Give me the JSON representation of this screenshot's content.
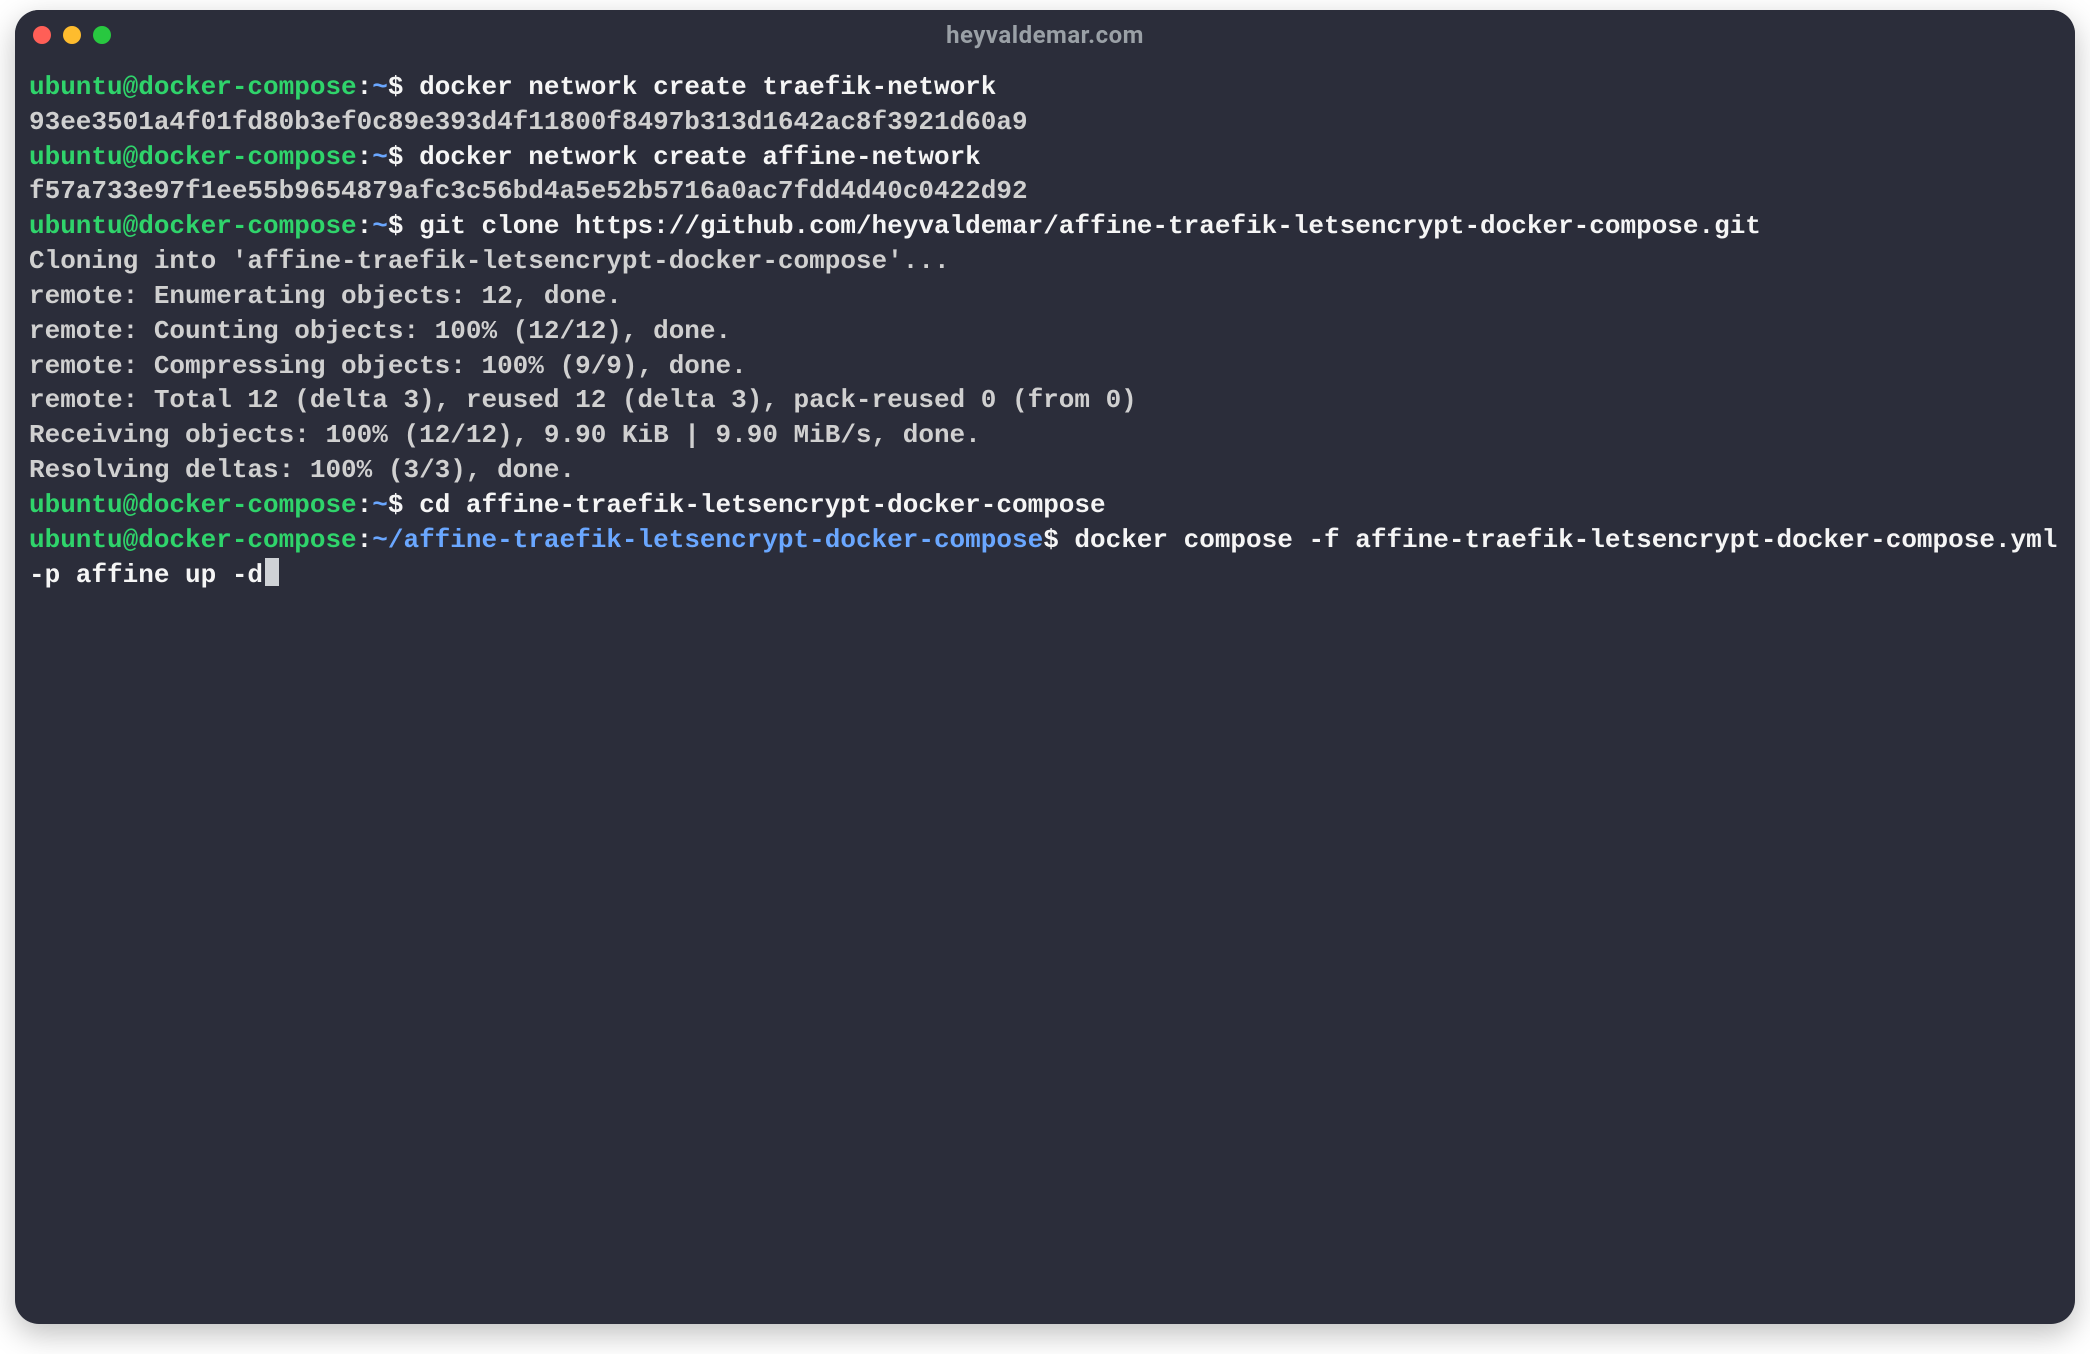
{
  "window": {
    "title": "heyvaldemar.com"
  },
  "lines": {
    "l1_user": "ubuntu@docker-compose",
    "l1_sep": ":",
    "l1_path": "~",
    "l1_dollar": "$",
    "l1_cmd": " docker network create traefik-network",
    "l2_out": "93ee3501a4f01fd80b3ef0c89e393d4f11800f8497b313d1642ac8f3921d60a9",
    "l3_user": "ubuntu@docker-compose",
    "l3_sep": ":",
    "l3_path": "~",
    "l3_dollar": "$",
    "l3_cmd": " docker network create affine-network",
    "l4_out": "f57a733e97f1ee55b9654879afc3c56bd4a5e52b5716a0ac7fdd4d40c0422d92",
    "l5_user": "ubuntu@docker-compose",
    "l5_sep": ":",
    "l5_path": "~",
    "l5_dollar": "$",
    "l5_cmd": " git clone https://github.com/heyvaldemar/affine-traefik-letsencrypt-docker-compose.git",
    "l6_out": "Cloning into 'affine-traefik-letsencrypt-docker-compose'...",
    "l7_out": "remote: Enumerating objects: 12, done.",
    "l8_out": "remote: Counting objects: 100% (12/12), done.",
    "l9_out": "remote: Compressing objects: 100% (9/9), done.",
    "l10_out": "remote: Total 12 (delta 3), reused 12 (delta 3), pack-reused 0 (from 0)",
    "l11_out": "Receiving objects: 100% (12/12), 9.90 KiB | 9.90 MiB/s, done.",
    "l12_out": "Resolving deltas: 100% (3/3), done.",
    "l13_user": "ubuntu@docker-compose",
    "l13_sep": ":",
    "l13_path": "~",
    "l13_dollar": "$",
    "l13_cmd": " cd affine-traefik-letsencrypt-docker-compose",
    "l14_user": "ubuntu@docker-compose",
    "l14_sep": ":",
    "l14_path": "~/affine-traefik-letsencrypt-docker-compose",
    "l14_dollar": "$",
    "l14_cmd": " docker compose -f affine-traefik-letsencrypt-docker-compose.yml -p affine up -d"
  }
}
